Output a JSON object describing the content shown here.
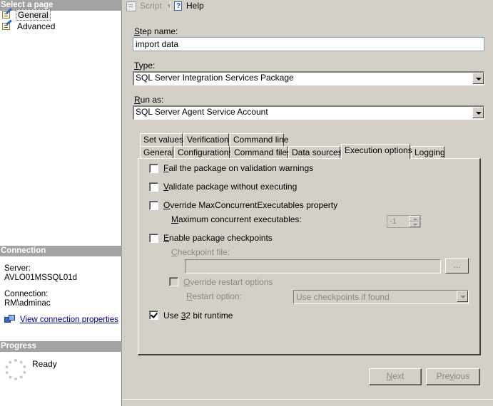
{
  "left_pane": {
    "select_page_header": "Select a page",
    "pages": [
      {
        "label": "General",
        "selected": true
      },
      {
        "label": "Advanced",
        "selected": false
      }
    ],
    "connection_header": "Connection",
    "server_label": "Server:",
    "server_value": "AVLO01MSSQL01d",
    "connection_label": "Connection:",
    "connection_value": "RM\\adminac",
    "view_connection_link": "View connection properties",
    "progress_header": "Progress",
    "progress_status": "Ready"
  },
  "toolbar": {
    "script_label": "Script",
    "help_label": "Help"
  },
  "form": {
    "step_name_label": "Step name:",
    "step_name_value": "import data",
    "type_label": "Type:",
    "type_value": "SQL Server Integration Services Package",
    "run_as_label": "Run as:",
    "run_as_value": "SQL Server Agent Service Account"
  },
  "tabs": {
    "row1": [
      "Set values",
      "Verification",
      "Command line"
    ],
    "row2": [
      "General",
      "Configurations",
      "Command files",
      "Data sources",
      "Execution options",
      "Logging"
    ],
    "active": "Execution options"
  },
  "execution_options": {
    "fail_on_warnings": {
      "label": "Fail the package on validation warnings",
      "checked": false
    },
    "validate_only": {
      "label": "Validate package without executing",
      "checked": false
    },
    "override_max": {
      "label": "Override MaxConcurrentExecutables property",
      "checked": false
    },
    "max_concurrent_label": "Maximum concurrent executables:",
    "max_concurrent_value": "-1",
    "enable_checkpoints": {
      "label": "Enable package checkpoints",
      "checked": false
    },
    "checkpoint_file_label": "Checkpoint file:",
    "checkpoint_file_value": "",
    "browse_label": "...",
    "override_restart": {
      "label": "Override restart options",
      "checked": false
    },
    "restart_option_label": "Restart option:",
    "restart_option_value": "Use checkpoints if found",
    "use_32bit": {
      "label": "Use 32 bit runtime",
      "checked": true
    }
  },
  "nav_buttons": {
    "next": "Next",
    "previous": "Previous"
  }
}
